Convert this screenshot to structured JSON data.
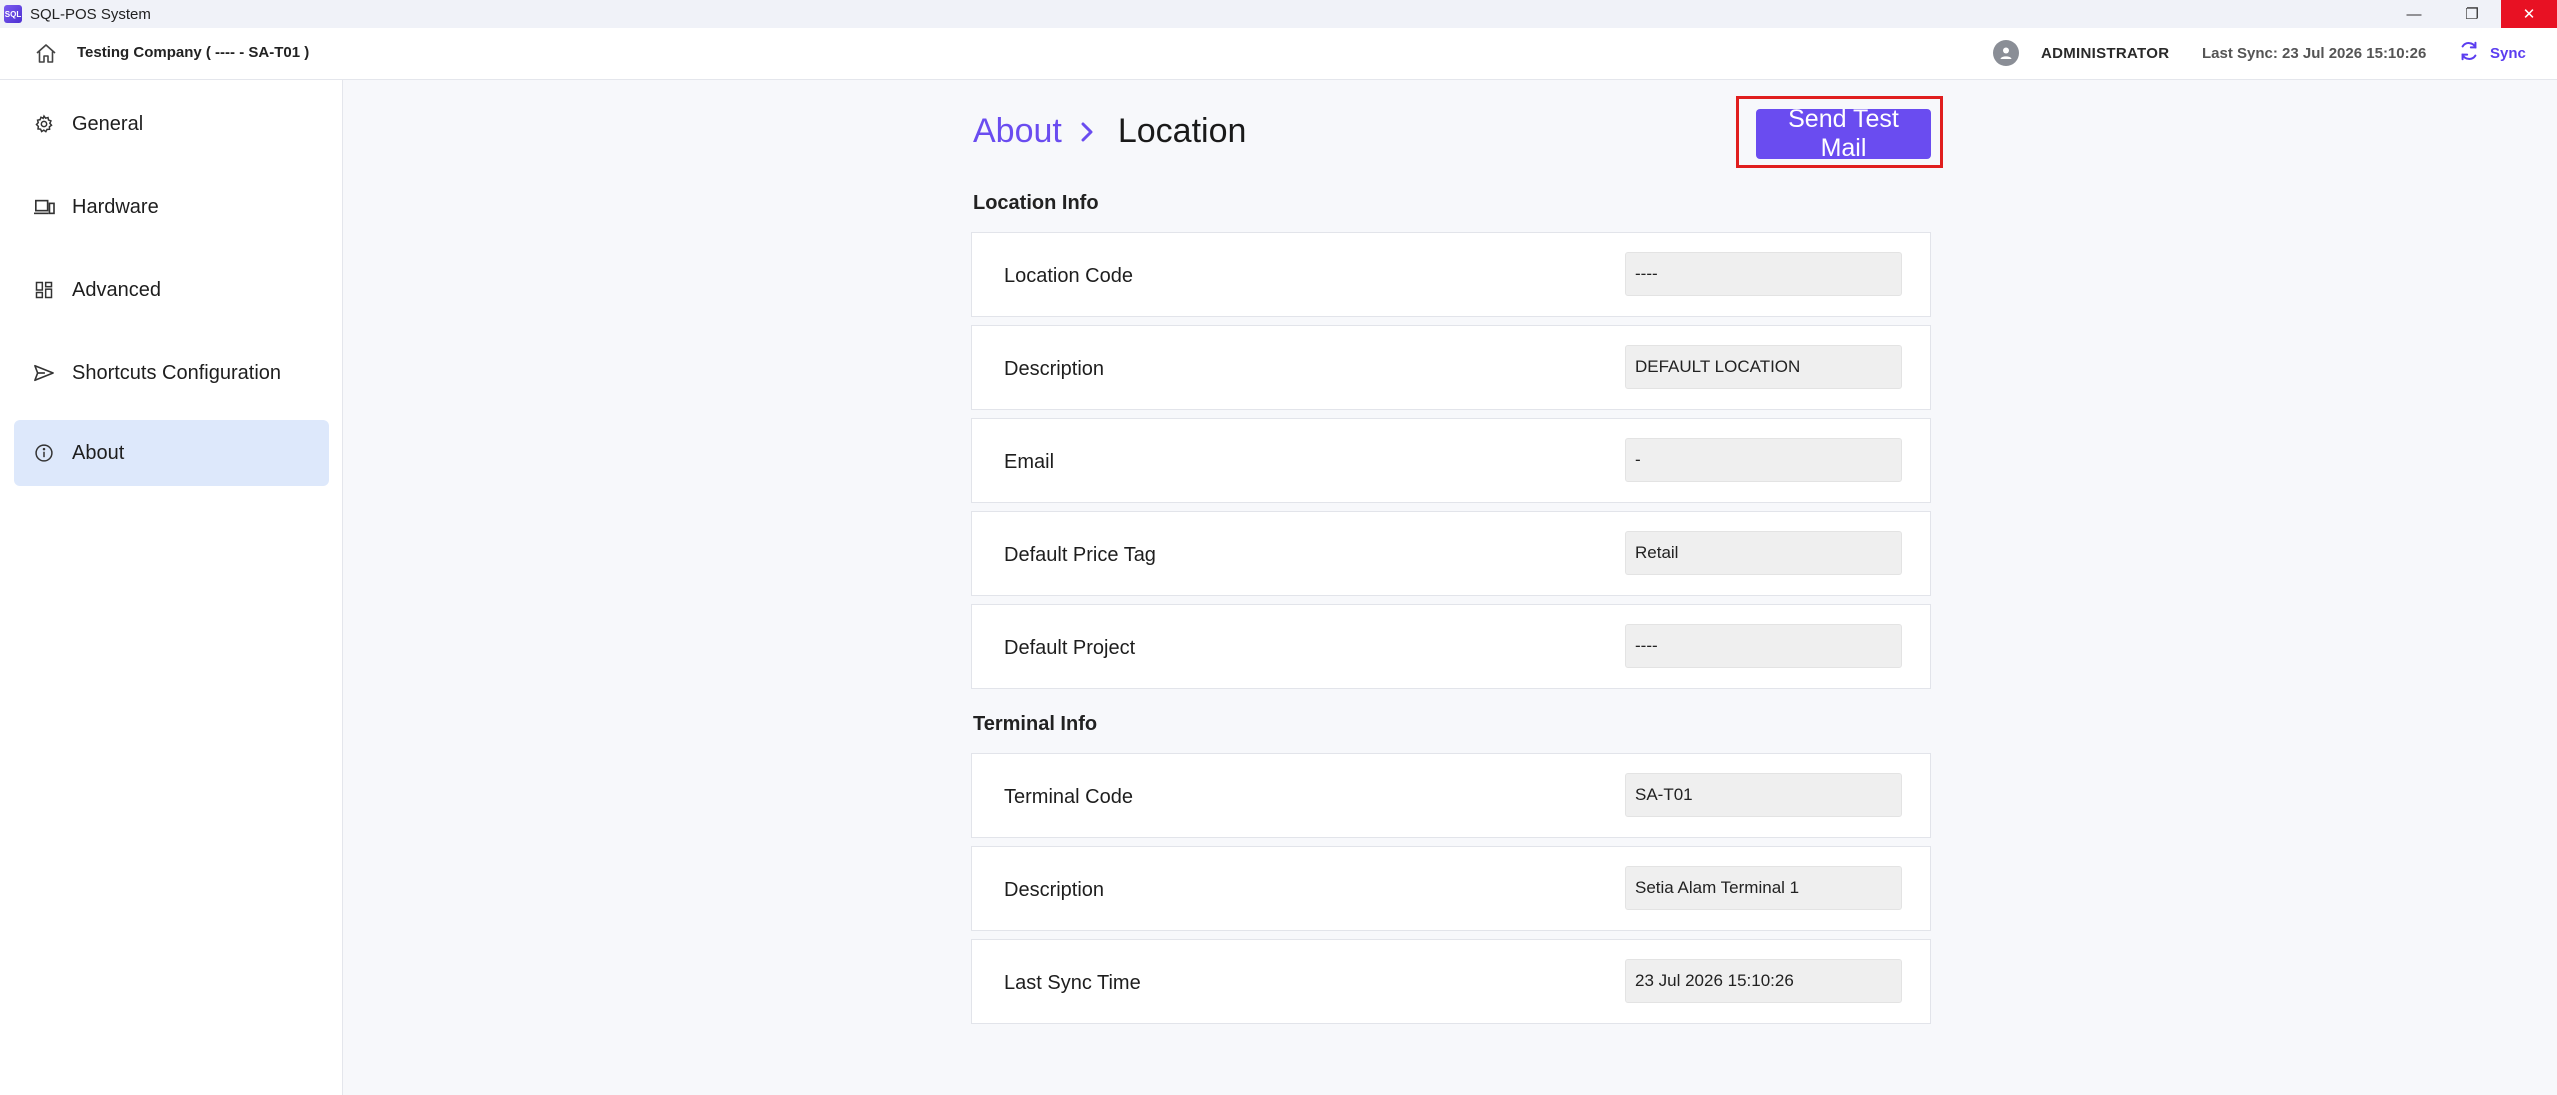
{
  "window": {
    "title": "SQL-POS System",
    "logo_text": "SQL",
    "minimize": "—",
    "restore": "❐",
    "close": "✕"
  },
  "header": {
    "company": "Testing Company ( ---- - SA-T01 )",
    "username": "ADMINISTRATOR",
    "last_sync": "Last Sync: 23 Jul 2026 15:10:26",
    "sync_label": "Sync"
  },
  "sidebar": {
    "items": [
      {
        "label": "General",
        "icon": "gear-icon"
      },
      {
        "label": "Hardware",
        "icon": "laptop-icon"
      },
      {
        "label": "Advanced",
        "icon": "grid-icon"
      },
      {
        "label": "Shortcuts Configuration",
        "icon": "send-icon"
      },
      {
        "label": "About",
        "icon": "info-icon",
        "active": true
      }
    ]
  },
  "breadcrumb": {
    "parent": "About",
    "current": "Location"
  },
  "actions": {
    "send_test_mail": "Send Test Mail"
  },
  "location_info": {
    "title": "Location Info",
    "fields": [
      {
        "label": "Location Code",
        "value": "----"
      },
      {
        "label": "Description",
        "value": "DEFAULT LOCATION"
      },
      {
        "label": "Email",
        "value": "-"
      },
      {
        "label": "Default Price Tag",
        "value": "Retail"
      },
      {
        "label": "Default Project",
        "value": "----"
      }
    ]
  },
  "terminal_info": {
    "title": "Terminal Info",
    "fields": [
      {
        "label": "Terminal Code",
        "value": "SA-T01"
      },
      {
        "label": "Description",
        "value": "Setia Alam Terminal 1"
      },
      {
        "label": "Last Sync Time",
        "value": "23 Jul 2026 15:10:26"
      }
    ]
  },
  "colors": {
    "accent": "#6a4cf0",
    "active_nav": "#dde8fb",
    "highlight_frame": "#e01e1e"
  }
}
